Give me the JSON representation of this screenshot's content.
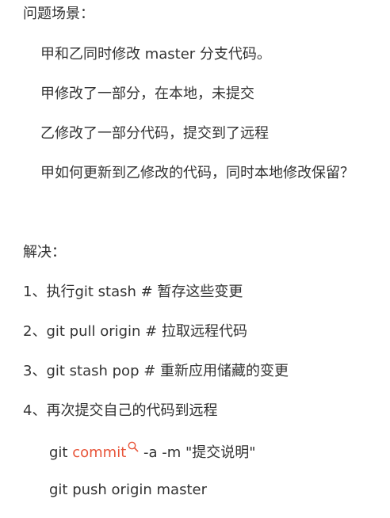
{
  "scenario": {
    "heading": "问题场景：",
    "lines": [
      "甲和乙同时修改 master 分支代码。",
      "甲修改了一部分，在本地，未提交",
      "乙修改了一部分代码，提交到了远程",
      "甲如何更新到乙修改的代码，同时本地修改保留？"
    ]
  },
  "solution": {
    "heading": "解决：",
    "steps": [
      "1、执行git stash  # 暂存这些变更",
      "2、git pull origin # 拉取远程代码",
      "3、git stash pop  # 重新应用储藏的变更",
      "4、再次提交自己的代码到远程"
    ],
    "commit_cmd": {
      "prefix": "git ",
      "keyword": "commit",
      "suffix": " -a -m \"提交说明\""
    },
    "push_cmd": "git push origin master"
  },
  "colors": {
    "text": "#333333",
    "keyword": "#e8553a"
  },
  "icons": {
    "keyword_search": "search-icon"
  }
}
